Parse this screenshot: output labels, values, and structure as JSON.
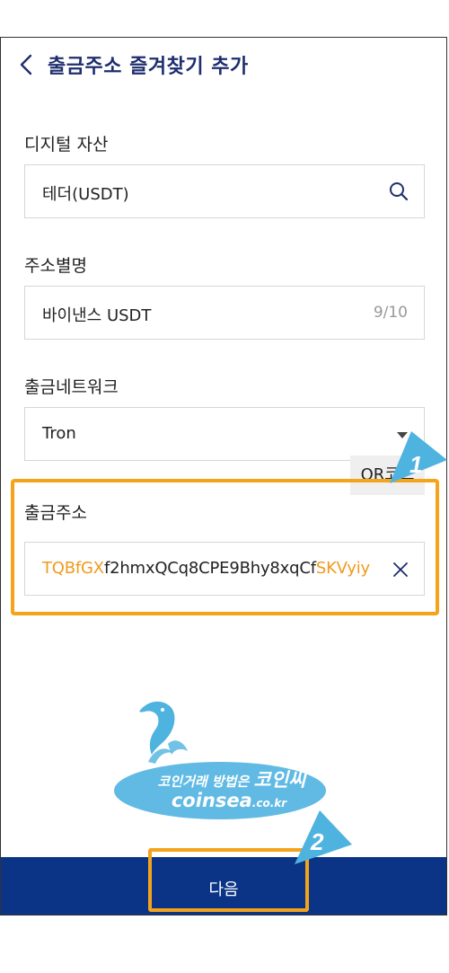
{
  "header": {
    "title": "출금주소 즐겨찾기 추가"
  },
  "asset": {
    "label": "디지털 자산",
    "value": "테더(USDT)"
  },
  "nickname": {
    "label": "주소별명",
    "value": "바이낸스 USDT",
    "counter": "9/10"
  },
  "network": {
    "label": "출금네트워크",
    "value": "Tron"
  },
  "address": {
    "label": "출금주소",
    "qr_label": "QR코드",
    "prefix": "TQBfGX",
    "middle": "f2hmxQCq8CPE9Bhy8xqCf",
    "suffix": "SKVyiy"
  },
  "footer": {
    "next_label": "다음"
  },
  "annotations": {
    "step1": "1",
    "step2": "2"
  },
  "watermark": {
    "line1_small": "코인거래 방법은",
    "line1_big": "코인씨",
    "domain_main": "coinsea",
    "domain_tld": ".co.kr"
  },
  "colors": {
    "primary": "#0b3487",
    "title": "#1e2e6e",
    "highlight": "#f09a1c",
    "annotation": "#f5a31a",
    "arrow": "#4fb3e0"
  }
}
